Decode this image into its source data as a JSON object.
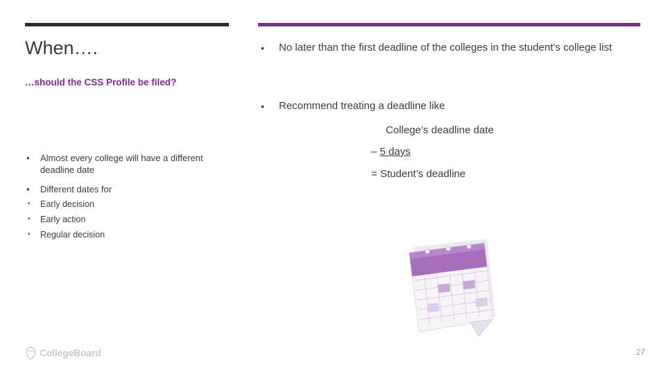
{
  "slide": {
    "title": "When….",
    "subtitle": "…should the CSS Profile be filed?",
    "page_number": "27",
    "accent_color": "#7b2b8f",
    "rule_color": "#2b2b22"
  },
  "left_column": {
    "bullets": [
      {
        "marker": "•",
        "text": "Almost every college will have a different deadline date"
      },
      {
        "marker": "•",
        "text": "Different dates for",
        "sub_bullets": [
          {
            "marker": "•",
            "text": "Early decision"
          },
          {
            "marker": "•",
            "text": "Early action"
          },
          {
            "marker": "•",
            "text": "Regular decision"
          }
        ]
      }
    ]
  },
  "right_column": {
    "bullets": [
      {
        "marker": "•",
        "text": "No later than the first deadline of the colleges in the student’s college list"
      },
      {
        "marker": "•",
        "text": "Recommend treating a deadline like"
      }
    ],
    "calculation": {
      "line1": "College’s deadline date",
      "line2_operator": "–",
      "line2_value": "5 days",
      "line3_operator": "=",
      "line3_value": "Student’s deadline"
    }
  },
  "image": {
    "name": "calendar-illustration",
    "alt": "Tear-off desk calendar with purple header"
  },
  "footer": {
    "logo_text": "CollegeBoard",
    "logo_icon": "acorn-icon"
  }
}
